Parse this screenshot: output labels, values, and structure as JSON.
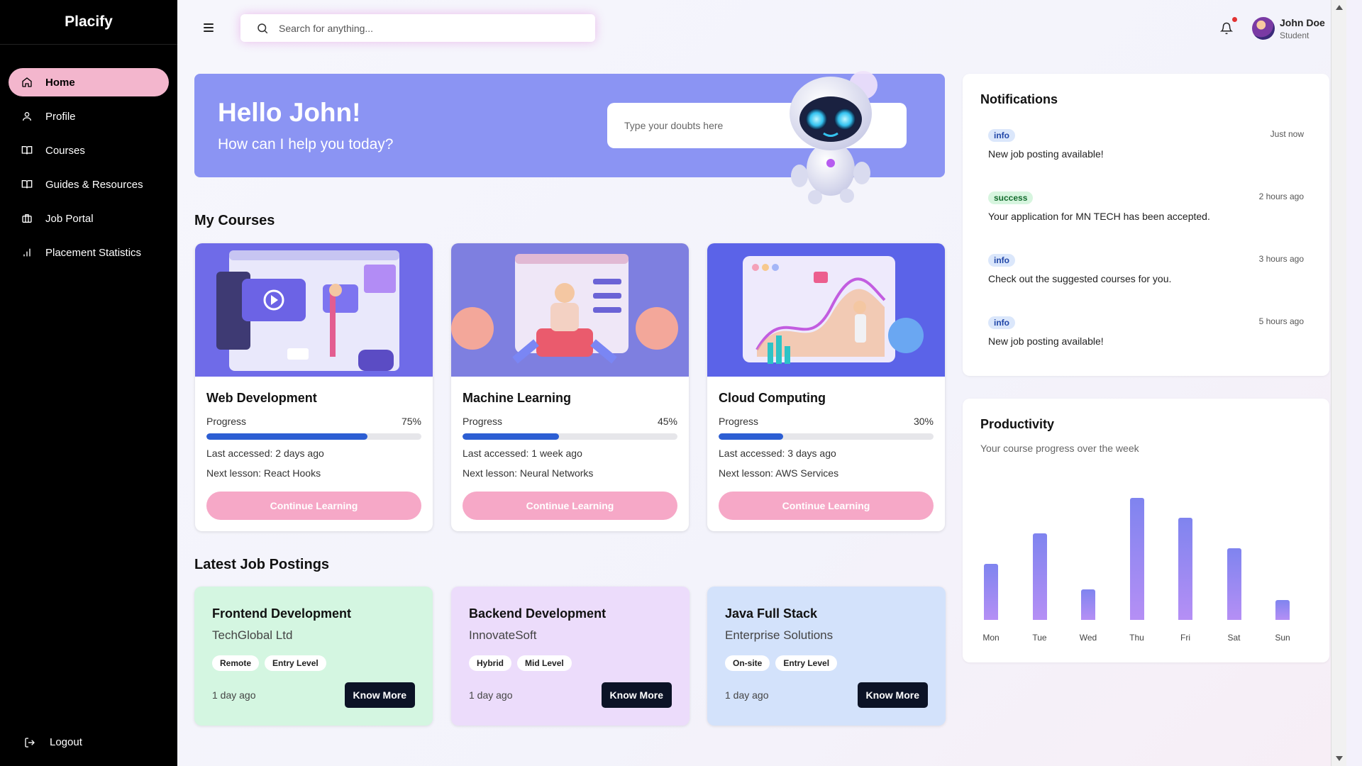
{
  "app": {
    "brand": "Placify"
  },
  "sidebar": {
    "items": [
      {
        "label": "Home",
        "icon": "home-icon",
        "active": true
      },
      {
        "label": "Profile",
        "icon": "user-icon"
      },
      {
        "label": "Courses",
        "icon": "book-open-icon"
      },
      {
        "label": "Guides & Resources",
        "icon": "book-icon"
      },
      {
        "label": "Job Portal",
        "icon": "briefcase-icon"
      },
      {
        "label": "Placement Statistics",
        "icon": "bar-chart-icon"
      }
    ],
    "logout_label": "Logout"
  },
  "header": {
    "search_placeholder": "Search for anything...",
    "user": {
      "name": "John Doe",
      "role": "Student"
    }
  },
  "hero": {
    "greeting": "Hello John!",
    "subtitle": "How can I help you today?",
    "input_placeholder": "Type your doubts here"
  },
  "courses": {
    "section_title": "My Courses",
    "items": [
      {
        "title": "Web Development",
        "progress_label": "Progress",
        "progress": 75,
        "progress_text": "75%",
        "last_accessed": "Last accessed: 2 days ago",
        "next_lesson": "Next lesson: React Hooks",
        "button": "Continue Learning"
      },
      {
        "title": "Machine Learning",
        "progress_label": "Progress",
        "progress": 45,
        "progress_text": "45%",
        "last_accessed": "Last accessed: 1 week ago",
        "next_lesson": "Next lesson: Neural Networks",
        "button": "Continue Learning"
      },
      {
        "title": "Cloud Computing",
        "progress_label": "Progress",
        "progress": 30,
        "progress_text": "30%",
        "last_accessed": "Last accessed: 3 days ago",
        "next_lesson": "Next lesson: AWS Services",
        "button": "Continue Learning"
      }
    ]
  },
  "jobs": {
    "section_title": "Latest Job Postings",
    "items": [
      {
        "title": "Frontend Development",
        "company": "TechGlobal Ltd",
        "tags": [
          "Remote",
          "Entry Level"
        ],
        "posted": "1 day ago",
        "button": "Know More",
        "bg": "#d4f6e1"
      },
      {
        "title": "Backend Development",
        "company": "InnovateSoft",
        "tags": [
          "Hybrid",
          "Mid Level"
        ],
        "posted": "1 day ago",
        "button": "Know More",
        "bg": "#ecdcfb"
      },
      {
        "title": "Java Full Stack",
        "company": "Enterprise Solutions",
        "tags": [
          "On-site",
          "Entry Level"
        ],
        "posted": "1 day ago",
        "button": "Know More",
        "bg": "#d3e2fb"
      }
    ]
  },
  "notifications": {
    "title": "Notifications",
    "items": [
      {
        "type": "info",
        "time": "Just now",
        "message": "New job posting available!"
      },
      {
        "type": "success",
        "time": "2 hours ago",
        "message": "Your application for MN TECH has been accepted."
      },
      {
        "type": "info",
        "time": "3 hours ago",
        "message": "Check out the suggested courses for you."
      },
      {
        "type": "info",
        "time": "5 hours ago",
        "message": "New job posting available!"
      }
    ]
  },
  "productivity": {
    "title": "Productivity",
    "subtitle": "Your course progress over the week"
  },
  "chart_data": {
    "type": "bar",
    "categories": [
      "Mon",
      "Tue",
      "Wed",
      "Thu",
      "Fri",
      "Sat",
      "Sun"
    ],
    "values": [
      46,
      71,
      25,
      100,
      84,
      59,
      16
    ],
    "ylim": [
      0,
      100
    ],
    "grid": false,
    "legend": "none",
    "colors": [
      "#7f84ef",
      "#b58ff5"
    ]
  }
}
